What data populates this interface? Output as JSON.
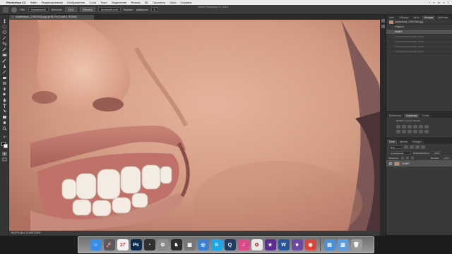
{
  "menubar": {
    "apple_glyph": "",
    "app_name": "Photoshop CC",
    "items": [
      "Файл",
      "Редактирование",
      "Изображение",
      "Слои",
      "Текст",
      "Выделение",
      "Фильтр",
      "3D",
      "Просмотр",
      "Окно",
      "Справка"
    ]
  },
  "window_title": "Adobe Photoshop CC 2015",
  "options_bar": {
    "mode_label": "Обр.",
    "mode_value": "Нормальный",
    "opacity_label": "Источник",
    "opacity_value": "100%",
    "sample_btn": "Образец",
    "sample_value": "Активный слой",
    "align_label": "Выравн.",
    "diffusion_label": "диффузия",
    "diffusion_value": "5"
  },
  "document_tab": {
    "close_glyph": "×",
    "title": "shutterstock_176979332.jpg @ 66,7% (Слой 0, RGB/8)"
  },
  "status_bar": "66,67%   Док: 19,4M/71,8M",
  "panels": {
    "top_tabs": [
      "Цвет",
      "Образцы",
      "Кисть",
      "История",
      "Действия"
    ],
    "history_active_tab": "История",
    "history": [
      {
        "label": "shutterstock_176979332.jpg",
        "state": "snap"
      },
      {
        "label": "Открыть",
        "state": "normal"
      },
      {
        "label": "Слой 0",
        "state": "sel"
      },
      {
        "label": "Точечная восстанавл. кисть",
        "state": "dim"
      },
      {
        "label": "Точечная восстанавл. кисть",
        "state": "dim"
      },
      {
        "label": "Точечная восстанавл. кисть",
        "state": "dim"
      },
      {
        "label": "Точечная восстанавл. кисть",
        "state": "dim"
      }
    ],
    "adj_tabs": [
      "Библиотеки",
      "Коррекция",
      "Стили"
    ],
    "adj_active_tab": "Коррекция",
    "adj_title": "Добавить корректировку",
    "layers_tabs": [
      "Слои",
      "Каналы",
      "Контуры"
    ],
    "layers_active_tab": "Слои",
    "layers_kind_label": "Вид",
    "blend_mode": "Нормальный",
    "opacity_label": "Непрозрачность:",
    "opacity_value": "100%",
    "lock_label": "Закрепить:",
    "fill_label": "Заливка:",
    "fill_value": "100%",
    "layers": [
      {
        "name": "Слой 0",
        "selected": true
      }
    ]
  },
  "dock": {
    "apps": [
      {
        "name": "finder",
        "glyph": "☺",
        "color": "#3a8ee6"
      },
      {
        "name": "launchpad",
        "glyph": "🚀",
        "color": "#5a5a5a"
      },
      {
        "name": "calendar",
        "glyph": "17",
        "color": "#f2f2f2"
      },
      {
        "name": "photoshop",
        "glyph": "Ps",
        "color": "#0b2b4a"
      },
      {
        "name": "dashboard",
        "glyph": "◔",
        "color": "#303030"
      },
      {
        "name": "system-preferences",
        "glyph": "⚙",
        "color": "#8a8a8a"
      },
      {
        "name": "chess",
        "glyph": "♞",
        "color": "#2c2c2c"
      },
      {
        "name": "utilities",
        "glyph": "▦",
        "color": "#777777"
      },
      {
        "name": "safari",
        "glyph": "◎",
        "color": "#3c7fd0"
      },
      {
        "name": "skype",
        "glyph": "S",
        "color": "#1aa7ec"
      },
      {
        "name": "quicktime",
        "glyph": "Q",
        "color": "#1e3c66"
      },
      {
        "name": "itunes",
        "glyph": "♫",
        "color": "#d94b8a"
      },
      {
        "name": "photos",
        "glyph": "✿",
        "color": "#e8e8e8"
      },
      {
        "name": "imovie",
        "glyph": "★",
        "color": "#5b2d91"
      },
      {
        "name": "word",
        "glyph": "W",
        "color": "#2a5699"
      },
      {
        "name": "other-app",
        "glyph": "■",
        "color": "#6a4aa0"
      },
      {
        "name": "chrome",
        "glyph": "◉",
        "color": "#d9443b"
      },
      {
        "name": "downloads-folder",
        "glyph": "▤",
        "color": "#4a90d9"
      },
      {
        "name": "documents-folder",
        "glyph": "▥",
        "color": "#5b9be0"
      },
      {
        "name": "trash",
        "glyph": "🗑",
        "color": "#9b9b9b"
      }
    ]
  }
}
